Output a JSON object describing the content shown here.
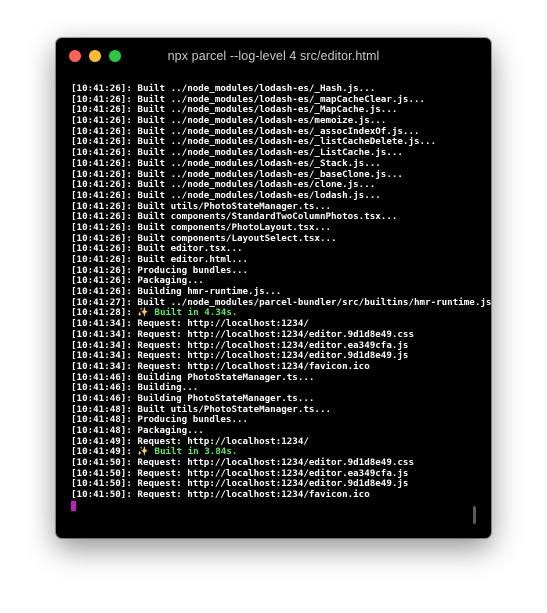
{
  "window": {
    "title": "npx parcel --log-level 4 src/editor.html"
  },
  "terminal": {
    "lines": [
      {
        "ts": "[10:41:26]:",
        "text": "Built ../node_modules/lodash-es/_Hash.js..."
      },
      {
        "ts": "[10:41:26]:",
        "text": "Built ../node_modules/lodash-es/_mapCacheClear.js..."
      },
      {
        "ts": "[10:41:26]:",
        "text": "Built ../node_modules/lodash-es/_MapCache.js..."
      },
      {
        "ts": "[10:41:26]:",
        "text": "Built ../node_modules/lodash-es/memoize.js..."
      },
      {
        "ts": "[10:41:26]:",
        "text": "Built ../node_modules/lodash-es/_assocIndexOf.js..."
      },
      {
        "ts": "[10:41:26]:",
        "text": "Built ../node_modules/lodash-es/_listCacheDelete.js..."
      },
      {
        "ts": "[10:41:26]:",
        "text": "Built ../node_modules/lodash-es/_ListCache.js..."
      },
      {
        "ts": "[10:41:26]:",
        "text": "Built ../node_modules/lodash-es/_Stack.js..."
      },
      {
        "ts": "[10:41:26]:",
        "text": "Built ../node_modules/lodash-es/_baseClone.js..."
      },
      {
        "ts": "[10:41:26]:",
        "text": "Built ../node_modules/lodash-es/clone.js..."
      },
      {
        "ts": "[10:41:26]:",
        "text": "Built ../node_modules/lodash-es/lodash.js..."
      },
      {
        "ts": "[10:41:26]:",
        "text": "Built utils/PhotoStateManager.ts..."
      },
      {
        "ts": "[10:41:26]:",
        "text": "Built components/StandardTwoColumnPhotos.tsx..."
      },
      {
        "ts": "[10:41:26]:",
        "text": "Built components/PhotoLayout.tsx..."
      },
      {
        "ts": "[10:41:26]:",
        "text": "Built components/LayoutSelect.tsx..."
      },
      {
        "ts": "[10:41:26]:",
        "text": "Built editor.tsx..."
      },
      {
        "ts": "[10:41:26]:",
        "text": "Built editor.html..."
      },
      {
        "ts": "[10:41:26]:",
        "text": "Producing bundles..."
      },
      {
        "ts": "[10:41:26]:",
        "text": "Packaging..."
      },
      {
        "ts": "[10:41:26]:",
        "text": "Building hmr-runtime.js..."
      },
      {
        "ts": "[10:41:27]:",
        "text": "Built ../node_modules/parcel-bundler/src/builtins/hmr-runtime.js..."
      },
      {
        "ts": "[10:41:28]:",
        "icon": "✨",
        "text": "Built in 4.34s.",
        "success": true
      },
      {
        "ts": "[10:41:34]:",
        "text": "Request: http://localhost:1234/"
      },
      {
        "ts": "[10:41:34]:",
        "text": "Request: http://localhost:1234/editor.9d1d8e49.css"
      },
      {
        "ts": "[10:41:34]:",
        "text": "Request: http://localhost:1234/editor.ea349cfa.js"
      },
      {
        "ts": "[10:41:34]:",
        "text": "Request: http://localhost:1234/editor.9d1d8e49.js"
      },
      {
        "ts": "[10:41:34]:",
        "text": "Request: http://localhost:1234/favicon.ico"
      },
      {
        "ts": "[10:41:46]:",
        "text": "Building PhotoStateManager.ts..."
      },
      {
        "ts": "[10:41:46]:",
        "text": "Building..."
      },
      {
        "ts": "[10:41:46]:",
        "text": "Building PhotoStateManager.ts..."
      },
      {
        "ts": "[10:41:48]:",
        "text": "Built utils/PhotoStateManager.ts..."
      },
      {
        "ts": "[10:41:48]:",
        "text": "Producing bundles..."
      },
      {
        "ts": "[10:41:48]:",
        "text": "Packaging..."
      },
      {
        "ts": "[10:41:49]:",
        "text": "Request: http://localhost:1234/"
      },
      {
        "ts": "[10:41:49]:",
        "icon": "✨",
        "text": "Built in 3.84s.",
        "success": true
      },
      {
        "ts": "[10:41:50]:",
        "text": "Request: http://localhost:1234/editor.9d1d8e49.css"
      },
      {
        "ts": "[10:41:50]:",
        "text": "Request: http://localhost:1234/editor.ea349cfa.js"
      },
      {
        "ts": "[10:41:50]:",
        "text": "Request: http://localhost:1234/editor.9d1d8e49.js"
      },
      {
        "ts": "[10:41:50]:",
        "text": "Request: http://localhost:1234/favicon.ico"
      }
    ]
  },
  "colors": {
    "background": "#000000",
    "text": "#ffffff",
    "success": "#4ff25a",
    "cursor": "#c21fc2",
    "close": "#ff5f57",
    "minimize": "#febc2e",
    "maximize": "#28c840"
  }
}
